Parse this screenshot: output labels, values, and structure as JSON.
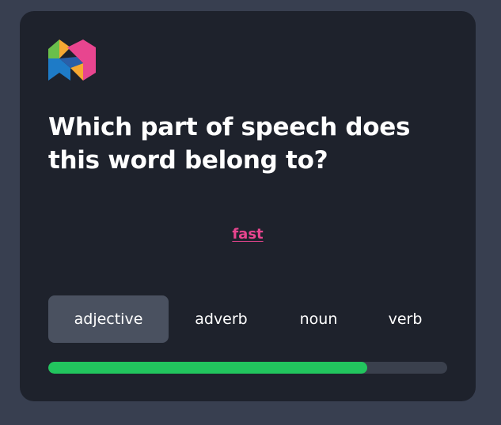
{
  "quiz": {
    "question": "Which part of speech does this word belong to?",
    "word": "fast",
    "options": [
      {
        "label": "adjective",
        "selected": true
      },
      {
        "label": "adverb",
        "selected": false
      },
      {
        "label": "noun",
        "selected": false
      },
      {
        "label": "verb",
        "selected": false
      }
    ],
    "progress_fraction": 0.8
  },
  "logo": {
    "icon": "brand-logo-icon",
    "colors": [
      "#6abf4b",
      "#f6a832",
      "#e8458f",
      "#1e7bc7",
      "#2a5fa8"
    ]
  },
  "colors": {
    "accent_word": "#e8458f",
    "progress": "#22c55e",
    "selected_option": "#4a5160"
  }
}
